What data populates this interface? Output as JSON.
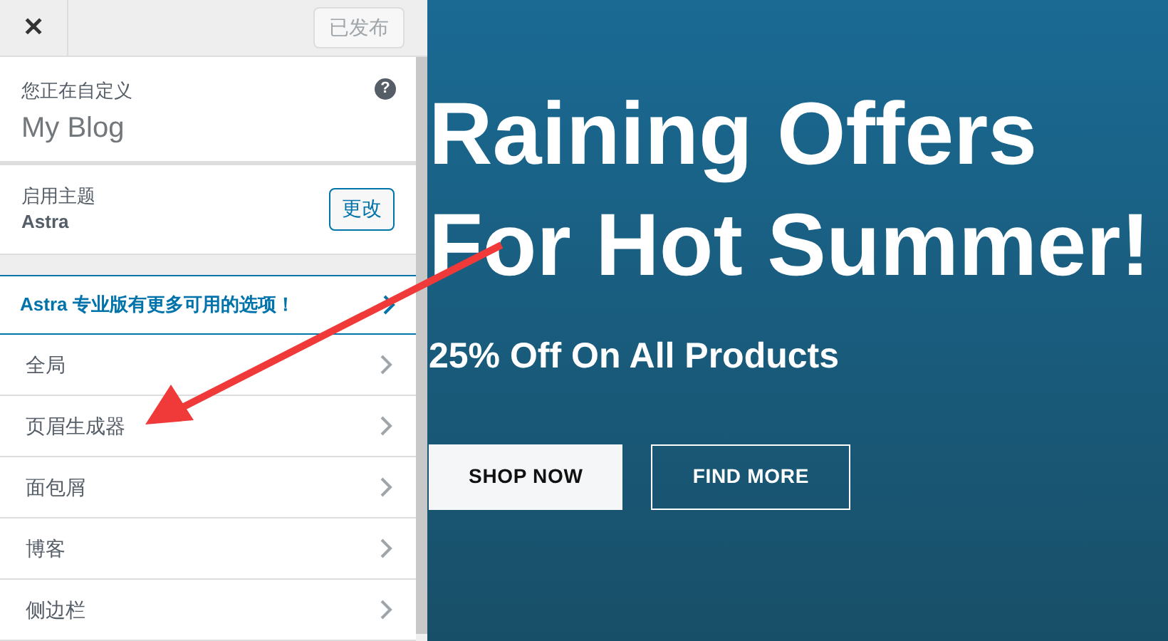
{
  "header": {
    "close": "✕",
    "publish_button": {
      "label": "已发布",
      "disabled": true
    }
  },
  "customizing": {
    "label": "您正在自定义",
    "site_title": "My Blog",
    "help": "?"
  },
  "theme": {
    "label": "启用主题",
    "name": "Astra",
    "change_button": "更改"
  },
  "promo": {
    "label": "Astra 专业版有更多可用的选项！"
  },
  "sections": [
    {
      "label": "全局"
    },
    {
      "label": "页眉生成器"
    },
    {
      "label": "面包屑"
    },
    {
      "label": "博客"
    },
    {
      "label": "侧边栏"
    }
  ],
  "preview": {
    "headline": [
      "Raining Offers",
      "For Hot Summer!"
    ],
    "subheading": "25% Off On All Products",
    "buttons": [
      {
        "label": "SHOP NOW",
        "kind": "solid"
      },
      {
        "label": "FIND MORE",
        "kind": "outline"
      }
    ]
  }
}
